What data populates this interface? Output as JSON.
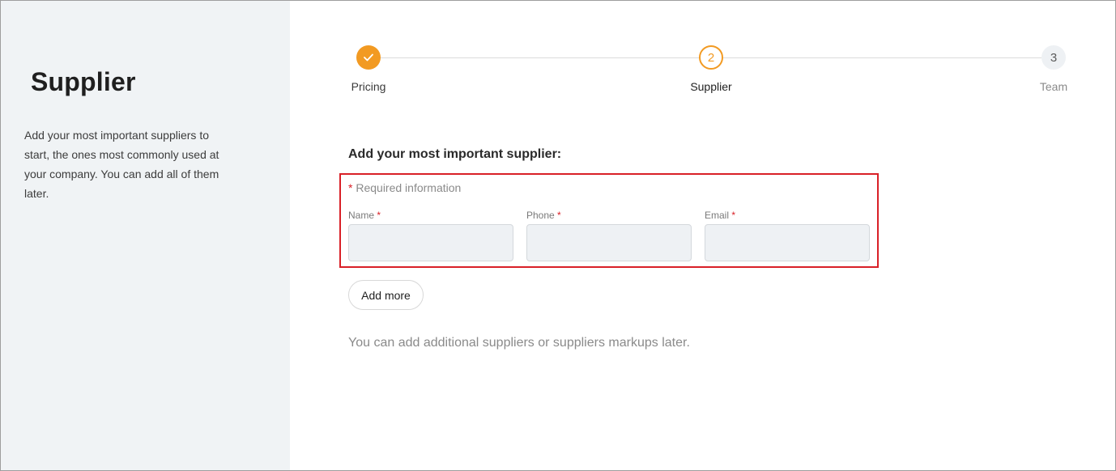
{
  "sidebar": {
    "title": "Supplier",
    "description": "Add your most important suppliers to start, the ones most commonly used at your company. You can add all of them later."
  },
  "stepper": {
    "steps": [
      {
        "label": "Pricing",
        "marker": "✓",
        "state": "completed"
      },
      {
        "label": "Supplier",
        "marker": "2",
        "state": "active"
      },
      {
        "label": "Team",
        "marker": "3",
        "state": "upcoming"
      }
    ]
  },
  "form": {
    "title": "Add your most important supplier:",
    "required_asterisk": "*",
    "required_note": "Required information",
    "fields": [
      {
        "label": "Name",
        "value": ""
      },
      {
        "label": "Phone",
        "value": ""
      },
      {
        "label": "Email",
        "value": ""
      }
    ],
    "add_more_label": "Add more",
    "footnote": "You can add additional suppliers or suppliers markups later."
  },
  "colors": {
    "accent": "#f29a22",
    "highlight": "#d92027",
    "sidebar_bg": "#f0f3f5",
    "input_bg": "#eef1f4"
  }
}
